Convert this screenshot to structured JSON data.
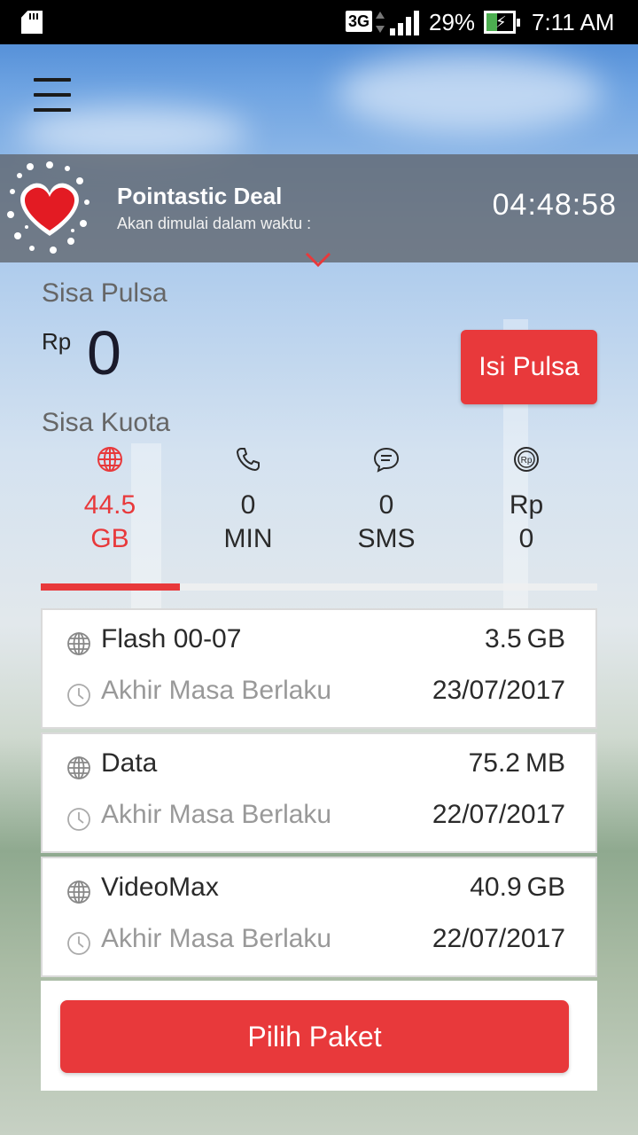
{
  "status_bar": {
    "network": "3G",
    "battery_percent": "29%",
    "time": "7:11 AM"
  },
  "deal": {
    "title": "Pointastic Deal",
    "subtitle": "Akan dimulai dalam waktu :",
    "timer": "04:48:58"
  },
  "balance": {
    "label": "Sisa Pulsa",
    "currency": "Rp",
    "amount": "0",
    "topup_label": "Isi Pulsa"
  },
  "quota": {
    "label": "Sisa Kuota",
    "items": [
      {
        "icon": "globe-icon",
        "value": "44.5",
        "unit": "GB"
      },
      {
        "icon": "phone-icon",
        "value": "0",
        "unit": "MIN"
      },
      {
        "icon": "chat-icon",
        "value": "0",
        "unit": "SMS"
      },
      {
        "icon": "rupiah-icon",
        "value": "Rp",
        "unit": "0"
      }
    ],
    "selected_index": 0,
    "progress_fraction": 0.25
  },
  "packages": [
    {
      "name": "Flash 00-07",
      "amount": "3.5 GB",
      "expiry_label": "Akhir Masa Berlaku",
      "expiry_date": "23/07/2017"
    },
    {
      "name": "Data",
      "amount": "75.2 MB",
      "expiry_label": "Akhir Masa Berlaku",
      "expiry_date": "22/07/2017"
    },
    {
      "name": "VideoMax",
      "amount": "40.9 GB",
      "expiry_label": "Akhir Masa Berlaku",
      "expiry_date": "22/07/2017"
    }
  ],
  "choose_package_label": "Pilih Paket",
  "colors": {
    "accent": "#e8393b",
    "text": "#2a2a2a",
    "muted": "#999999"
  }
}
